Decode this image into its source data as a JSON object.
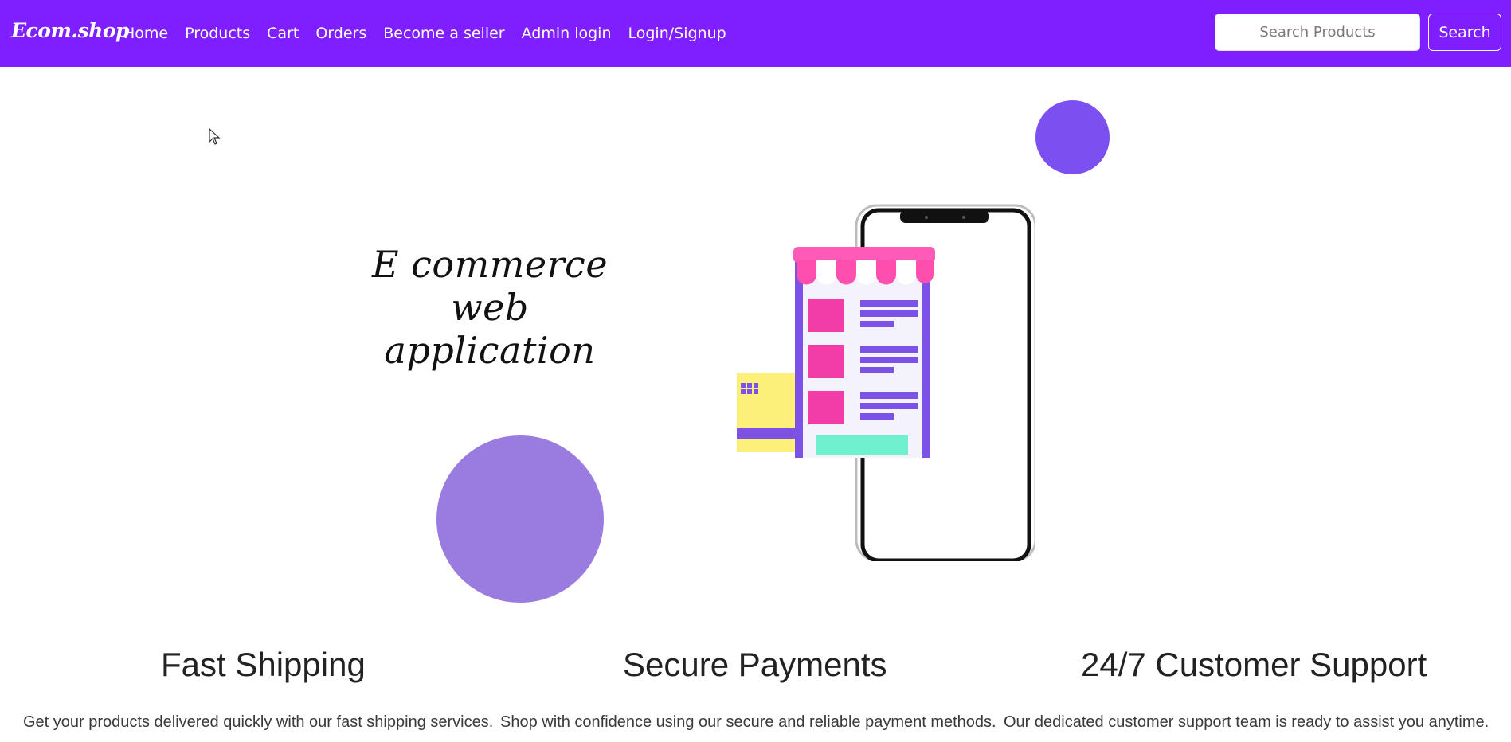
{
  "navbar": {
    "brand": "Ecom.shop",
    "links": [
      "Home",
      "Products",
      "Cart",
      "Orders",
      "Become a seller",
      "Admin login",
      "Login/Signup"
    ],
    "search_placeholder": "Search Products",
    "search_button": "Search",
    "background_color": "#7f1fff"
  },
  "hero": {
    "title_line1": "E commerce web",
    "title_line2": "application",
    "illustration_icon": "shop-on-phone-icon",
    "accent_circle_colors": [
      "#7b4ff0",
      "#9a7be0"
    ]
  },
  "features": [
    {
      "title": "Fast Shipping",
      "description": "Get your products delivered quickly with our fast shipping services."
    },
    {
      "title": "Secure Payments",
      "description": "Shop with confidence using our secure and reliable payment methods."
    },
    {
      "title": "24/7 Customer Support",
      "description": "Our dedicated customer support team is ready to assist you anytime."
    }
  ]
}
